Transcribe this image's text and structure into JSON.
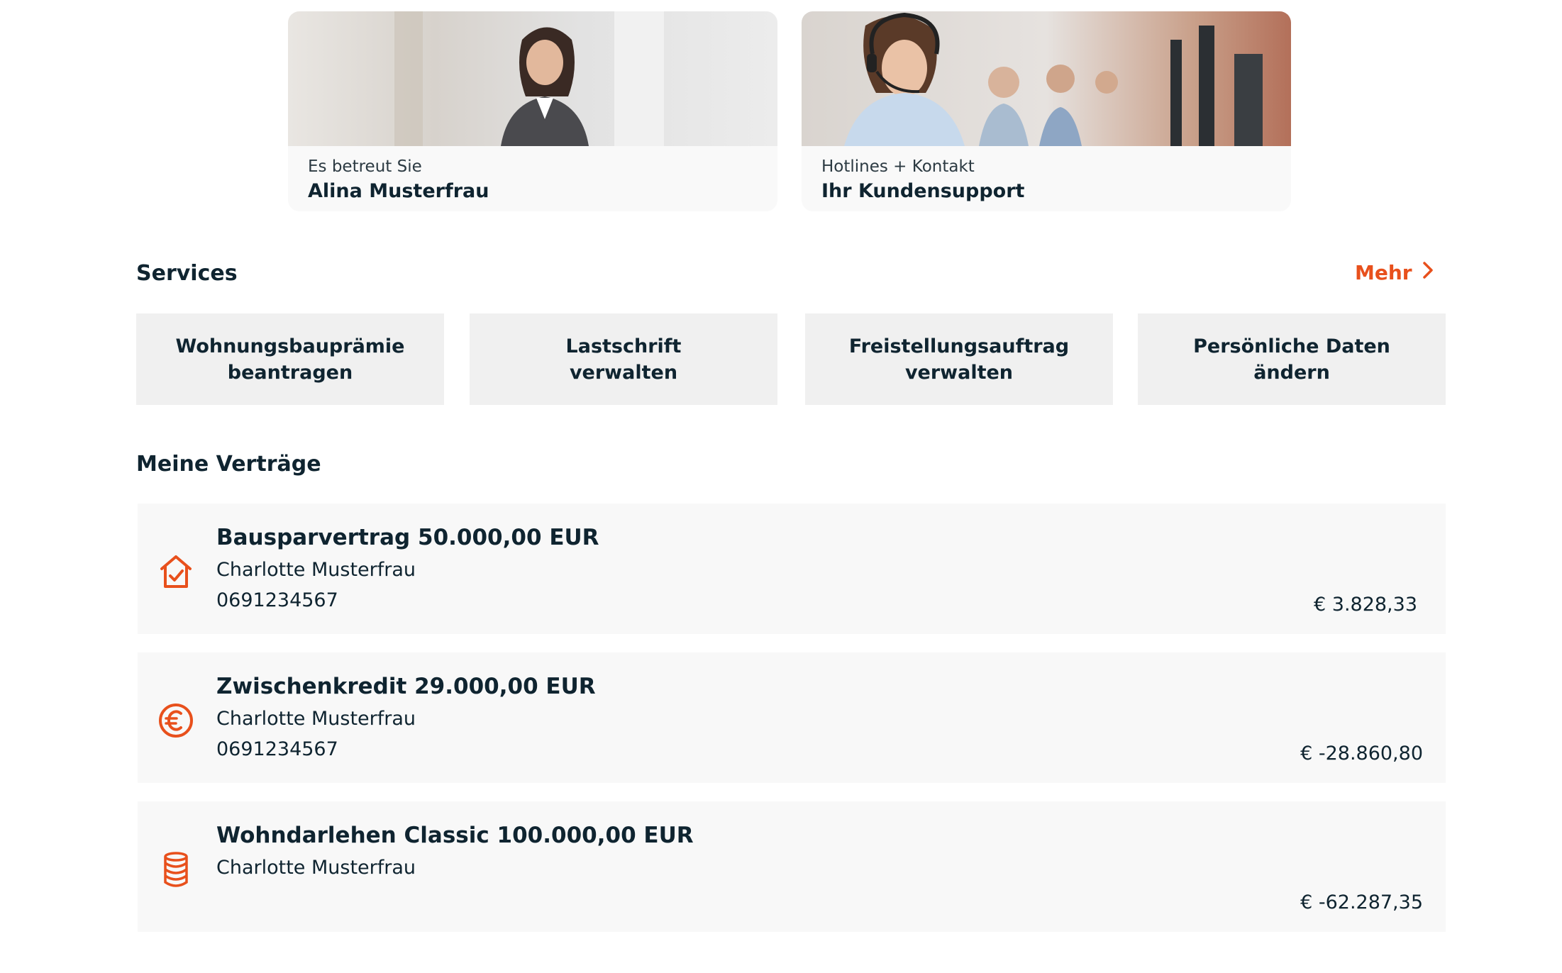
{
  "contacts": [
    {
      "subtitle": "Es betreut Sie",
      "title": "Alina Musterfrau"
    },
    {
      "subtitle": "Hotlines + Kontakt",
      "title": "Ihr Kundensupport"
    }
  ],
  "services": {
    "title": "Services",
    "more_label": "Mehr",
    "tiles": [
      {
        "line1": "Wohnungsbauprämie",
        "line2": "beantragen"
      },
      {
        "line1": "Lastschrift",
        "line2": "verwalten"
      },
      {
        "line1": "Freistellungsauftrag",
        "line2": "verwalten"
      },
      {
        "line1": "Persönliche Daten",
        "line2": "ändern"
      }
    ]
  },
  "contracts": {
    "title": "Meine Verträge",
    "items": [
      {
        "icon": "house-check-icon",
        "title": "Bausparvertrag 50.000,00 EUR",
        "owner": "Charlotte Musterfrau",
        "number": "0691234567",
        "amount": "€ 3.828,33"
      },
      {
        "icon": "euro-circle-icon",
        "title": "Zwischenkredit 29.000,00 EUR",
        "owner": "Charlotte Musterfrau",
        "number": "0691234567",
        "amount": "€ -28.860,80"
      },
      {
        "icon": "coin-stack-icon",
        "title": "Wohndarlehen Classic 100.000,00 EUR",
        "owner": "Charlotte Musterfrau",
        "amount": "€ -62.287,35"
      }
    ]
  },
  "colors": {
    "accent": "#e8501c",
    "text": "#0f2430",
    "tile_bg": "#f0f0f0",
    "card_bg": "#f8f8f8"
  }
}
